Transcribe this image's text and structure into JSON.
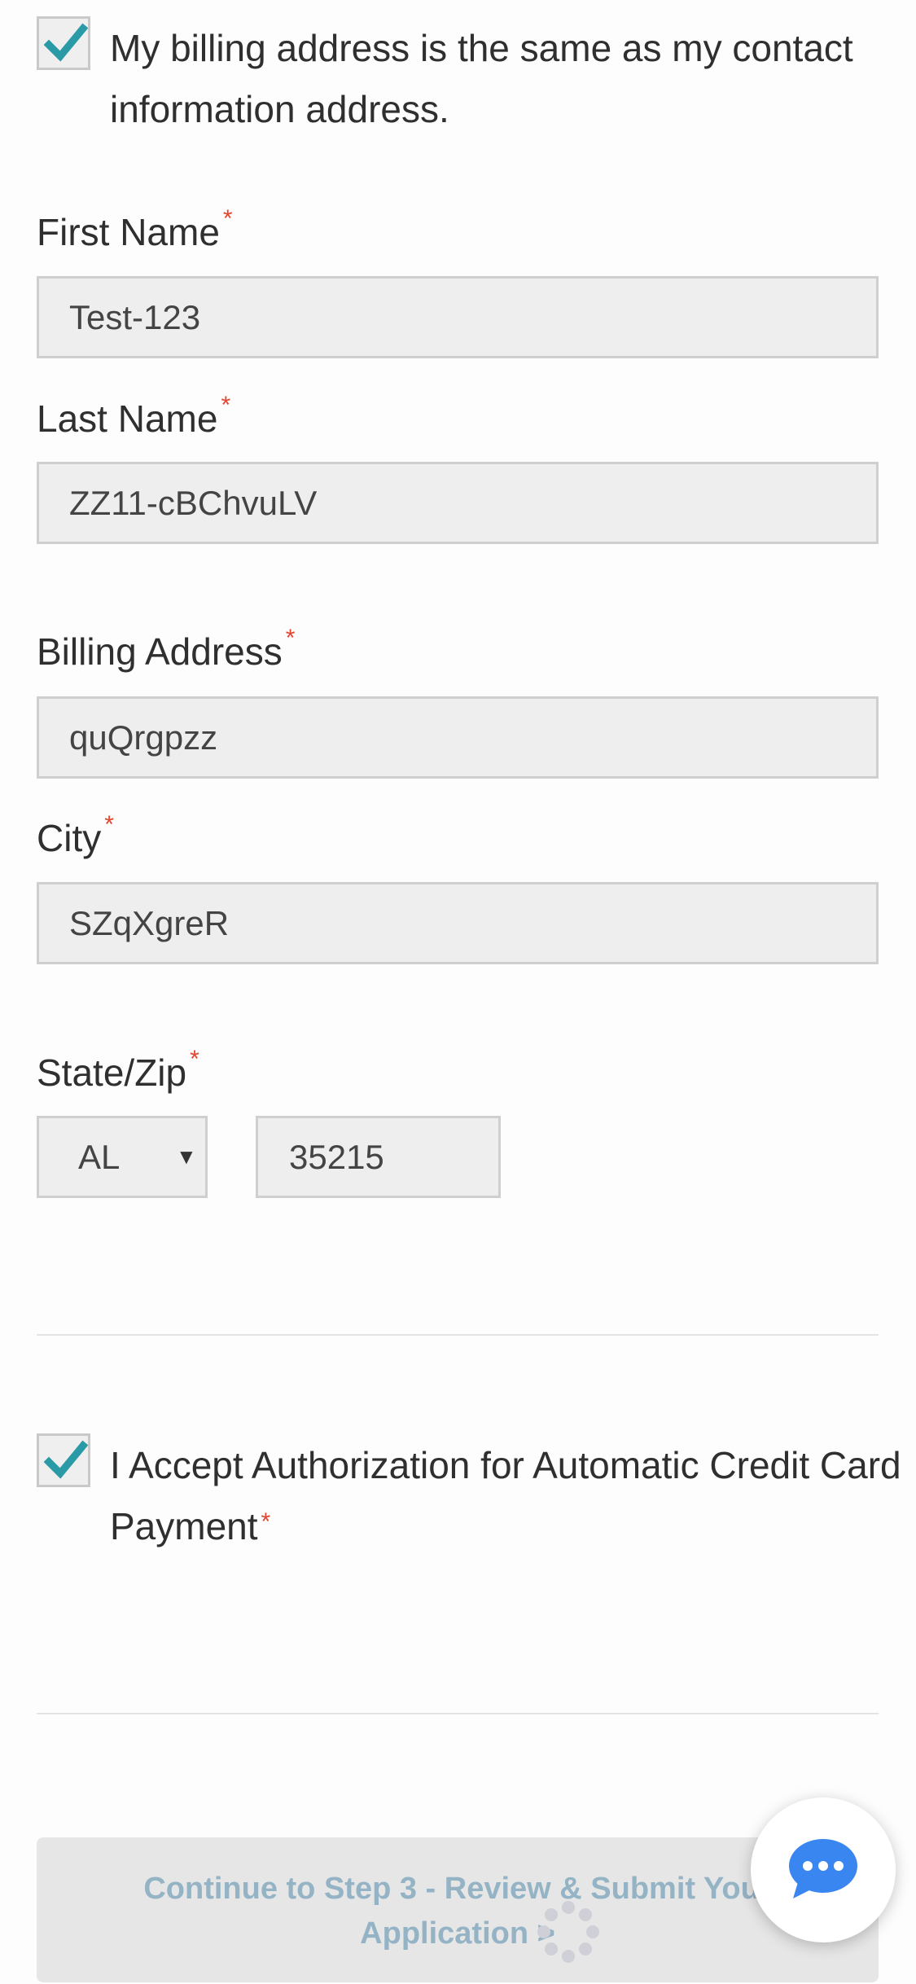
{
  "billing_same": {
    "checked": true,
    "label": "My billing address is the same as my contact information address."
  },
  "form": {
    "first_name": {
      "label": "First Name",
      "required": "*",
      "value": "Test-123"
    },
    "last_name": {
      "label": "Last Name",
      "required": "*",
      "value": "ZZ11-cBChvuLV"
    },
    "billing_address": {
      "label": "Billing Address",
      "required": "*",
      "value": "quQrgpzz"
    },
    "city": {
      "label": "City",
      "required": "*",
      "value": "SZqXgreR"
    },
    "state_zip": {
      "label": "State/Zip",
      "required": "*",
      "state": "AL",
      "zip": "35215"
    }
  },
  "authorization": {
    "checked": true,
    "label": "I Accept Authorization for Automatic Credit Card Payment",
    "required": "*"
  },
  "continue_button": {
    "label": "Continue to Step 3 - Review & Submit Your Application >"
  },
  "icons": {
    "checkbox_check": "checkmark-icon",
    "select_arrow": "▼",
    "loading": "spinner-icon",
    "chat": "chat-bubble-icon"
  },
  "colors": {
    "checkmark": "#2a9aa6",
    "required": "#e3452f",
    "button_text": "#94b3c5",
    "chat": "#3a86f0"
  }
}
